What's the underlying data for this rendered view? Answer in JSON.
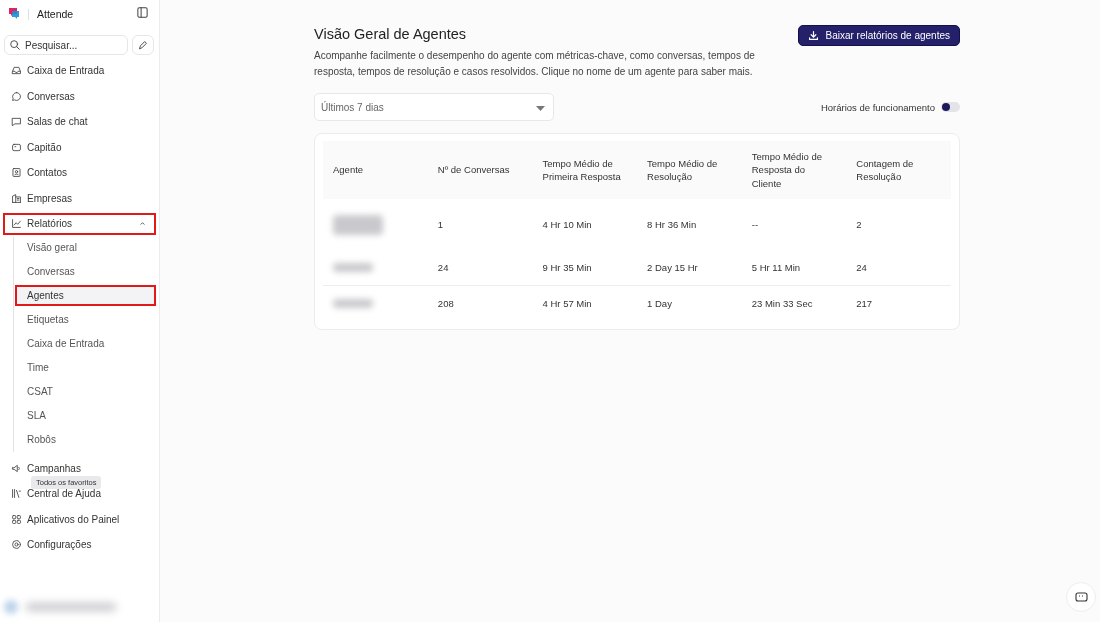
{
  "sidebar": {
    "brand": "Attende",
    "search": {
      "placeholder": "Pesquisar..."
    },
    "items": [
      {
        "label": "Caixa de Entrada",
        "highlighted": false
      },
      {
        "label": "Conversas",
        "highlighted": false
      },
      {
        "label": "Salas de chat",
        "highlighted": false
      },
      {
        "label": "Capitão",
        "highlighted": false
      },
      {
        "label": "Contatos",
        "highlighted": false
      },
      {
        "label": "Empresas",
        "highlighted": false
      },
      {
        "label": "Relatórios",
        "highlighted": true,
        "expanded": true,
        "children": [
          {
            "label": "Visão geral",
            "selected": false,
            "highlighted": false
          },
          {
            "label": "Conversas",
            "selected": false,
            "highlighted": false
          },
          {
            "label": "Agentes",
            "selected": true,
            "highlighted": true
          },
          {
            "label": "Etiquetas",
            "selected": false,
            "highlighted": false
          },
          {
            "label": "Caixa de Entrada",
            "selected": false,
            "highlighted": false
          },
          {
            "label": "Time",
            "selected": false,
            "highlighted": false
          },
          {
            "label": "CSAT",
            "selected": false,
            "highlighted": false
          },
          {
            "label": "SLA",
            "selected": false,
            "highlighted": false
          },
          {
            "label": "Robôs",
            "selected": false,
            "highlighted": false
          }
        ]
      },
      {
        "label": "Campanhas",
        "highlighted": false
      },
      {
        "label": "Central de Ajuda",
        "highlighted": false
      },
      {
        "label": "Aplicativos do Painel",
        "highlighted": false
      },
      {
        "label": "Configurações",
        "highlighted": false
      }
    ],
    "tooltip": "Todos os favoritos"
  },
  "page": {
    "title": "Visão Geral de Agentes",
    "description": "Acompanhe facilmente o desempenho do agente com métricas-chave, como conversas, tempos de resposta, tempos de resolução e casos resolvidos. Clique no nome de um agente para saber mais.",
    "download_button": "Baixar relatórios de agentes",
    "range_select": "Últimos 7 dias",
    "business_hours": {
      "label": "Horários de funcionamento",
      "on": false
    }
  },
  "table": {
    "columns": [
      "Agente",
      "Nº de Conversas",
      "Tempo Médio de Primeira Resposta",
      "Tempo Médio de Resolução",
      "Tempo Médio de Resposta do Cliente",
      "Contagem de Resolução"
    ],
    "rows": [
      {
        "cells": [
          "",
          "1",
          "4 Hr 10 Min",
          "8 Hr 36 Min",
          "--",
          "2"
        ]
      },
      {
        "cells": [
          "",
          "24",
          "9 Hr 35 Min",
          "2 Day 15 Hr",
          "5 Hr 11 Min",
          "24"
        ]
      },
      {
        "cells": [
          "",
          "208",
          "4 Hr 57 Min",
          "1 Day",
          "23 Min 33 Sec",
          "217"
        ]
      }
    ]
  }
}
